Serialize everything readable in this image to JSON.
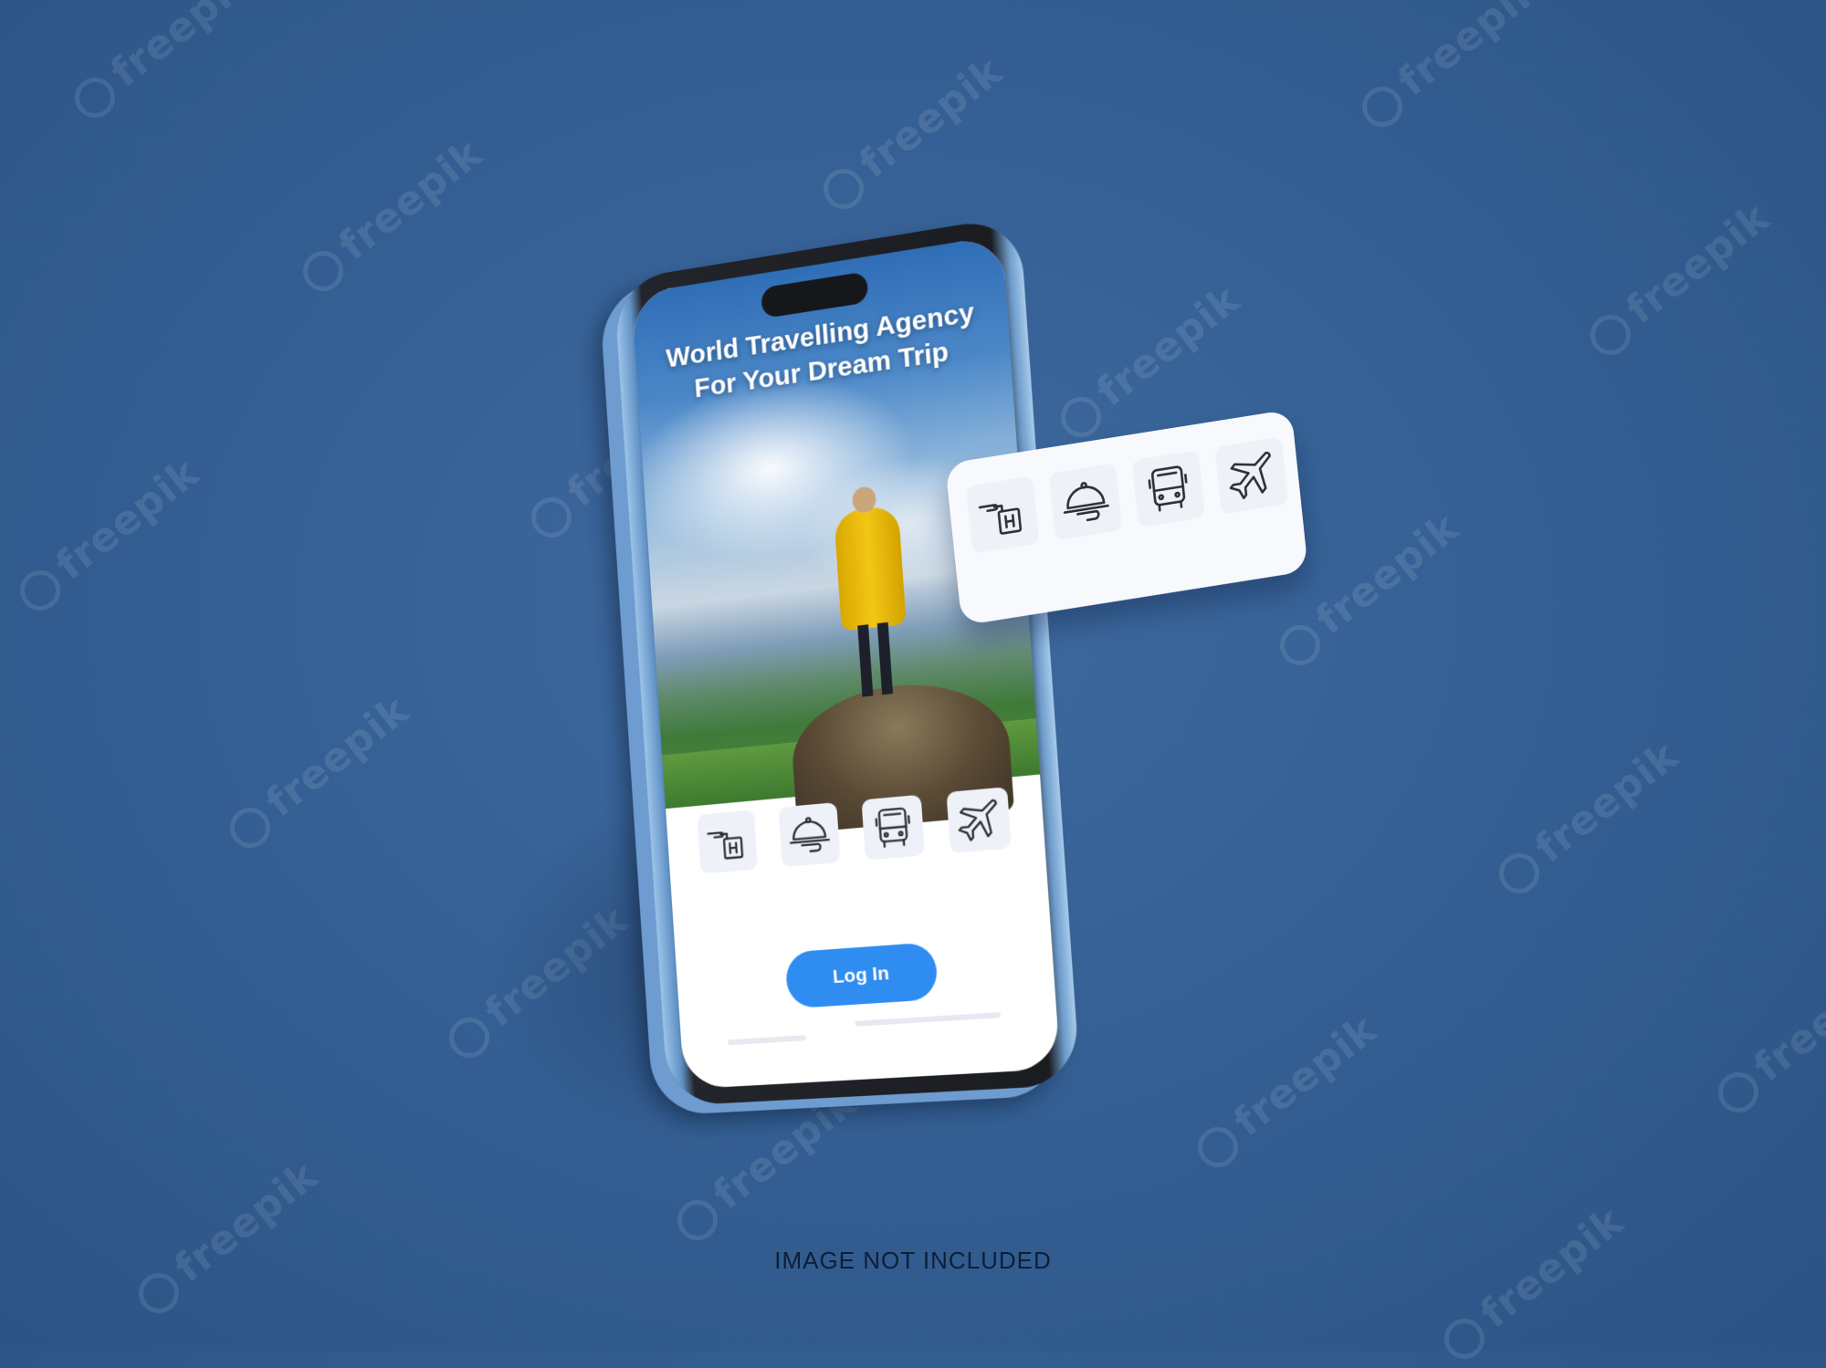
{
  "watermark": {
    "text": "freepik"
  },
  "app": {
    "title_line1": "World Travelling Agency",
    "title_line2": "For Your Dream Trip",
    "login_label": "Log In"
  },
  "icons": [
    {
      "name": "hotel-icon",
      "label": ""
    },
    {
      "name": "restaurant-cloche-icon",
      "label": ""
    },
    {
      "name": "bus-icon",
      "label": ""
    },
    {
      "name": "airplane-icon",
      "label": ""
    }
  ],
  "caption": "IMAGE NOT INCLUDED",
  "colors": {
    "background": "#356095",
    "accent": "#2f8cf0",
    "coat": "#f3c615"
  }
}
